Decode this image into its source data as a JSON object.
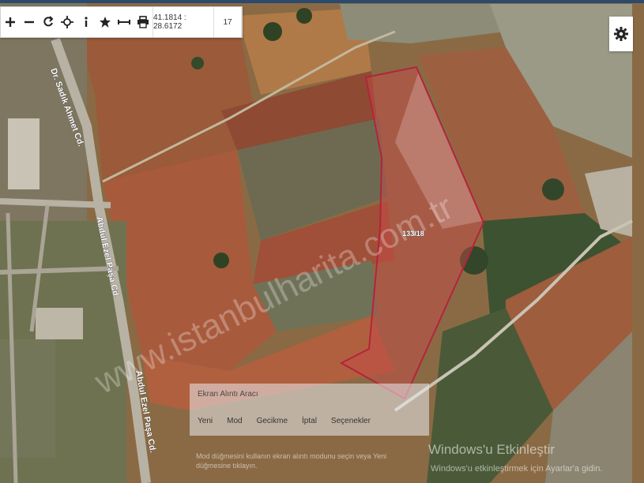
{
  "toolbar": {
    "tools": [
      {
        "name": "zoom-in-icon",
        "label": "+"
      },
      {
        "name": "zoom-out-icon",
        "label": "−"
      },
      {
        "name": "refresh-icon",
        "label": "↻"
      },
      {
        "name": "crosshair-icon",
        "label": "⌖"
      },
      {
        "name": "info-icon",
        "label": "i"
      },
      {
        "name": "star-icon",
        "label": "★"
      },
      {
        "name": "measure-icon",
        "label": "↔"
      },
      {
        "name": "print-icon",
        "label": "⎙"
      }
    ],
    "coordinates": "41.1814 : 28.6172",
    "zoom_level": "17"
  },
  "map": {
    "parcel_label": "133/18",
    "road_labels": [
      "Dr. Sadık Ahmet Cd.",
      "Abdul Ezel Paşa Cd.",
      "Abdul Ezel Paşa Cd."
    ],
    "watermark": "www.istanbulharita.com.tr",
    "parcel_color": "#b3243c"
  },
  "settings_icon": "gear-icon",
  "overlay": {
    "snip_title": "Ekran Alıntı Aracı",
    "snip_options": [
      "Yeni",
      "Mod",
      "Gecikme",
      "İptal",
      "Seçenekler"
    ],
    "snip_hint": "Mod düğmesini kullanın ekran alıntı modunu seçin veya Yeni düğmesine tıklayın.",
    "activate_title": "Windows'u Etkinleştir",
    "activate_subtitle": "Windows'u etkinleştirmek için Ayarlar'a gidin."
  }
}
